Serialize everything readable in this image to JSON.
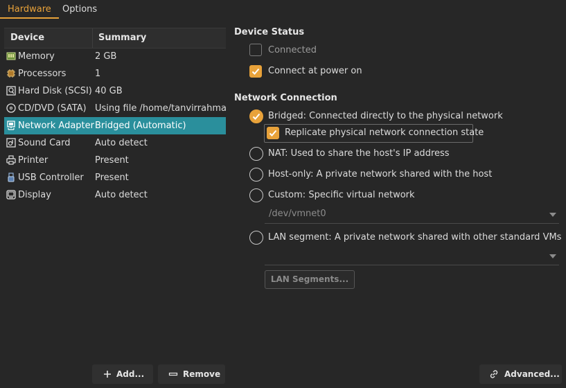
{
  "tabs": [
    {
      "label": "Hardware",
      "active": true
    },
    {
      "label": "Options",
      "active": false
    }
  ],
  "device_list": {
    "headers": {
      "device": "Device",
      "summary": "Summary"
    },
    "rows": [
      {
        "icon": "memory-icon",
        "device": "Memory",
        "summary": "2 GB"
      },
      {
        "icon": "processor-icon",
        "device": "Processors",
        "summary": "1"
      },
      {
        "icon": "hard-disk-icon",
        "device": "Hard Disk (SCSI)",
        "summary": "40 GB"
      },
      {
        "icon": "cd-dvd-icon",
        "device": "CD/DVD (SATA)",
        "summary": "Using file /home/tanvirrahman"
      },
      {
        "icon": "network-adapter-icon",
        "device": "Network Adapter",
        "summary": "Bridged (Automatic)",
        "selected": true
      },
      {
        "icon": "sound-card-icon",
        "device": "Sound Card",
        "summary": "Auto detect"
      },
      {
        "icon": "printer-icon",
        "device": "Printer",
        "summary": "Present"
      },
      {
        "icon": "usb-controller-icon",
        "device": "USB Controller",
        "summary": "Present"
      },
      {
        "icon": "display-icon",
        "device": "Display",
        "summary": "Auto detect"
      }
    ]
  },
  "device_status": {
    "title": "Device Status",
    "connected": {
      "label": "Connected",
      "checked": false,
      "enabled": false
    },
    "connect_at_power_on": {
      "label": "Connect at power on",
      "checked": true
    }
  },
  "network_connection": {
    "title": "Network Connection",
    "bridged": {
      "label": "Bridged: Connected directly to the physical network",
      "checked": true
    },
    "replicate": {
      "label": "Replicate physical network connection state",
      "checked": true
    },
    "nat": {
      "label": "NAT: Used to share the host's IP address",
      "checked": false
    },
    "host_only": {
      "label": "Host-only: A private network shared with the host",
      "checked": false
    },
    "custom": {
      "label": "Custom: Specific virtual network",
      "checked": false,
      "dropdown_value": "/dev/vmnet0"
    },
    "lan_segment": {
      "label": "LAN segment: A private network shared with other standard VMs",
      "checked": false,
      "dropdown_value": ""
    },
    "lan_segments_button": "LAN Segments..."
  },
  "buttons": {
    "add": "Add...",
    "remove": "Remove",
    "advanced": "Advanced..."
  },
  "colors": {
    "accent": "#e8a23a",
    "selection": "#2a8f9c",
    "background": "#272727"
  }
}
